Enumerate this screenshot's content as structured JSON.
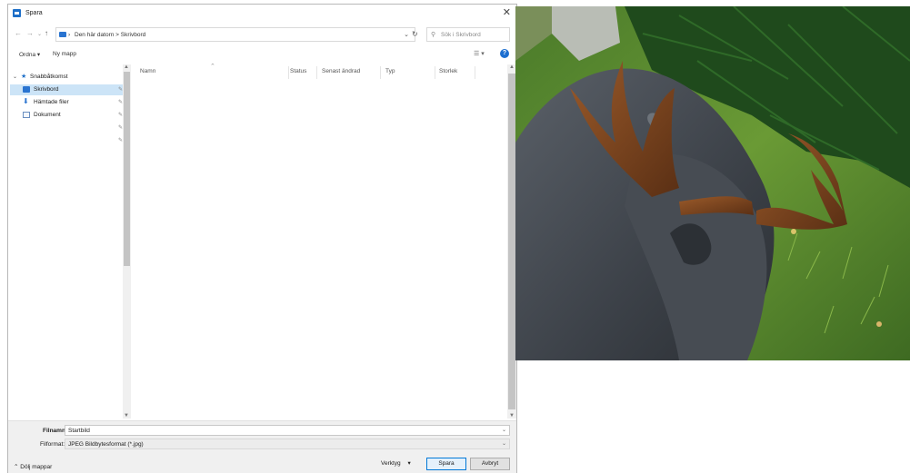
{
  "dialog": {
    "title": "Spara",
    "address": "Den här datorn  >  Skrivbord",
    "search_placeholder": "Sök i Skrivbord",
    "toolbar": {
      "organize": "Ordna ▾",
      "new_folder": "Ny mapp"
    },
    "nav": {
      "quick_access": "Snabbåtkomst",
      "items": [
        "Skrivbord",
        "Hämtade filer",
        "Dokument"
      ]
    },
    "columns": [
      "Namn",
      "Status",
      "Senast ändrad",
      "Typ",
      "Storlek"
    ],
    "filename_label": "Filnamn:",
    "filename_value": "Startbild",
    "filetype_label": "Filformat:",
    "filetype_value": "JPEG Bildbytesformat (*.jpg)",
    "hide_folders": "Dölj mappar",
    "tools": "Verktyg",
    "save": "Spara",
    "cancel": "Avbryt"
  },
  "colors": {
    "accent": "#0078d7",
    "selection": "#cce4f7"
  }
}
